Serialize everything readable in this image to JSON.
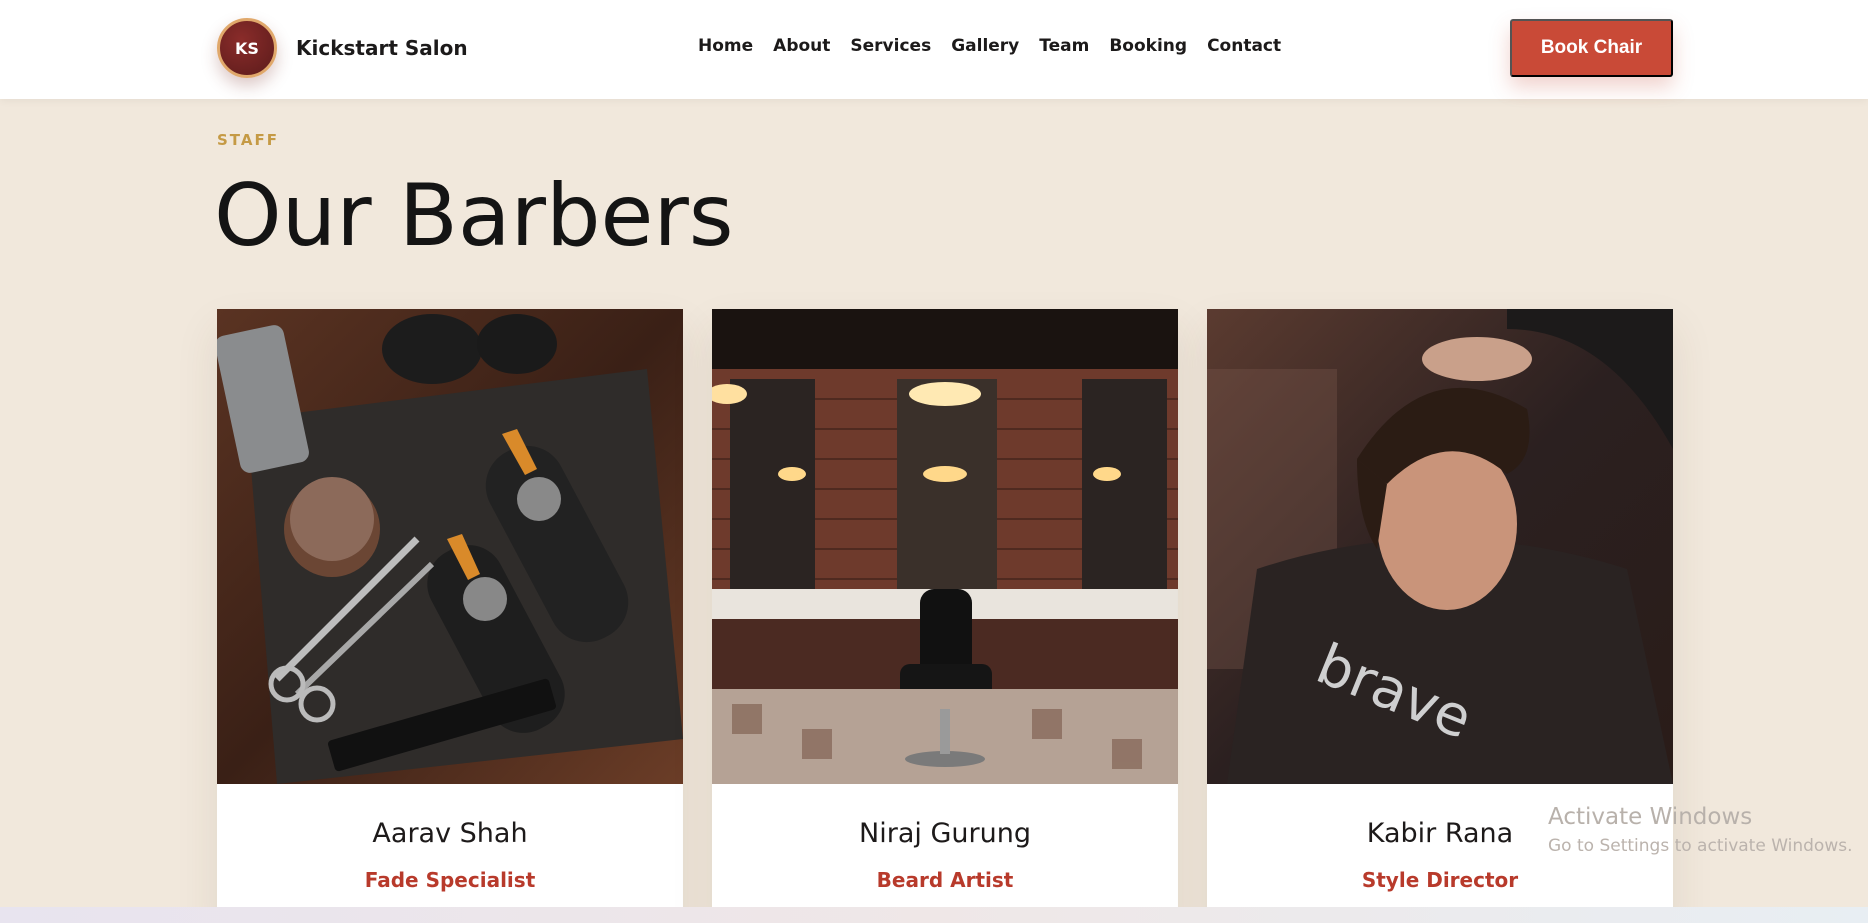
{
  "header": {
    "logo_initials": "KS",
    "brand_name": "Kickstart Salon",
    "nav": [
      "Home",
      "About",
      "Services",
      "Gallery",
      "Team",
      "Booking",
      "Contact"
    ],
    "cta_label": "Book Chair"
  },
  "section": {
    "eyebrow": "STAFF",
    "title": "Our Barbers"
  },
  "barbers": [
    {
      "name": "Aarav Shah",
      "role": "Fade Specialist"
    },
    {
      "name": "Niraj Gurung",
      "role": "Beard Artist"
    },
    {
      "name": "Kabir Rana",
      "role": "Style Director"
    }
  ],
  "watermark": {
    "title": "Activate Windows",
    "subtitle": "Go to Settings to activate Windows."
  },
  "colors": {
    "background": "#f1e8dc",
    "accent": "#c94a37",
    "role_text": "#b83a2b",
    "eyebrow": "#c59a45"
  }
}
